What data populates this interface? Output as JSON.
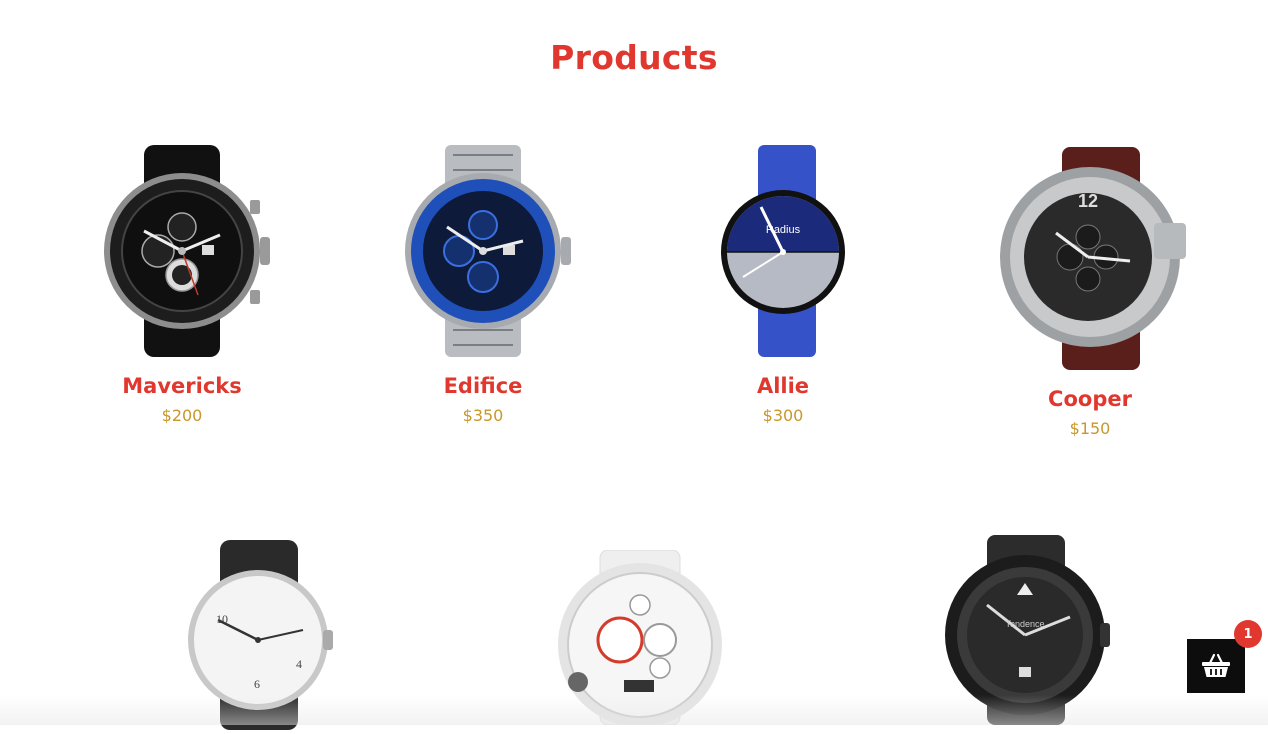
{
  "header": {
    "title": "Products"
  },
  "products": [
    {
      "name": "Mavericks",
      "price": "$200"
    },
    {
      "name": "Edifice",
      "price": "$350"
    },
    {
      "name": "Allie",
      "price": "$300"
    },
    {
      "name": "Cooper",
      "price": "$150"
    }
  ],
  "watch_dial_text": {
    "allie": "Radius",
    "cooper": "12",
    "tendence": "Tendence"
  },
  "cart": {
    "count": "1",
    "icon": "basket-icon"
  },
  "colors": {
    "accent": "#e0382f",
    "price": "#c9972a",
    "cart_bg": "#0d0d0d"
  }
}
